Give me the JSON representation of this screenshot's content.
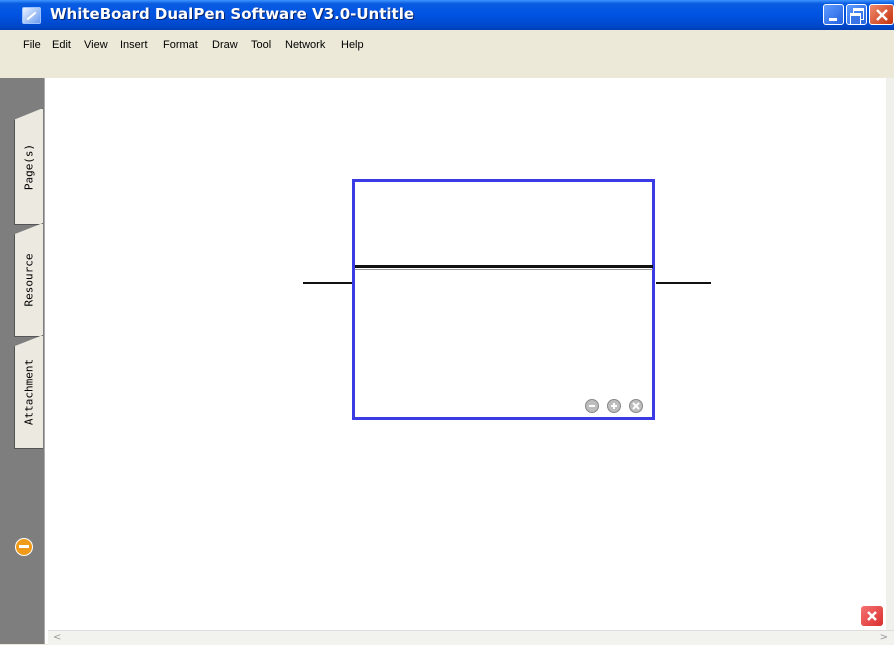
{
  "window": {
    "title": "WhiteBoard DualPen Software V3.0-Untitle"
  },
  "menu": {
    "items": [
      {
        "label": "File"
      },
      {
        "label": "Edit"
      },
      {
        "label": "View"
      },
      {
        "label": "Insert"
      },
      {
        "label": "Format"
      },
      {
        "label": "Draw"
      },
      {
        "label": "Tool"
      },
      {
        "label": "Network"
      },
      {
        "label": "Help"
      }
    ]
  },
  "sidebar": {
    "tabs": [
      {
        "label": "Page(s)"
      },
      {
        "label": "Resource"
      },
      {
        "label": "Attachment"
      }
    ]
  },
  "colors": {
    "titlebar": "#0054e3",
    "selection_border": "#3b3be6",
    "sidebar": "#7e7e7e",
    "accent_orange": "#f09a1a"
  }
}
